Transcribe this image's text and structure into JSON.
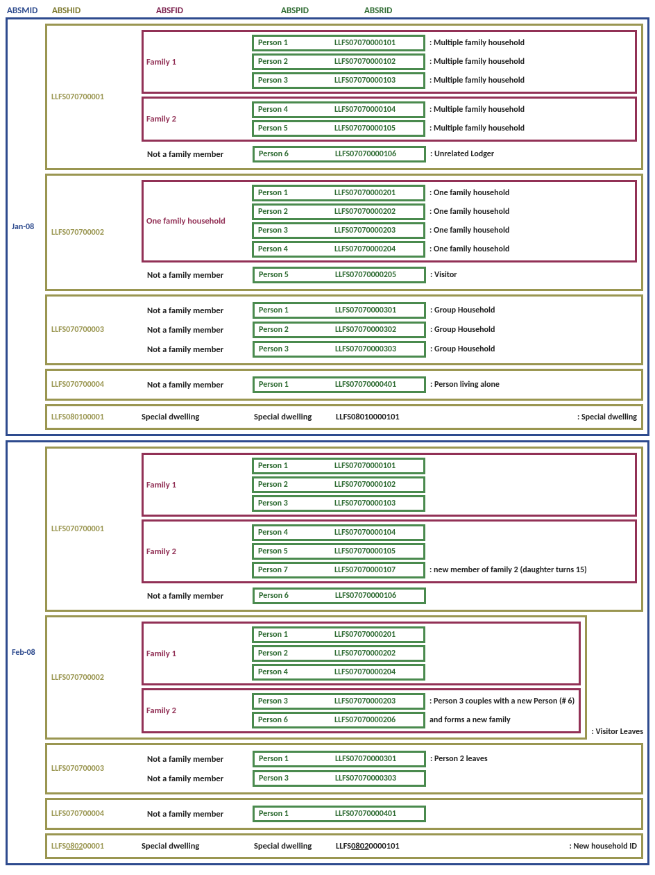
{
  "headers": {
    "absmid": "ABSMID",
    "abshid": "ABSHID",
    "absfid": "ABSFID",
    "abspid": "ABSPID",
    "absrid": "ABSRID"
  },
  "labels": {
    "not_family": "Not a family member",
    "special": "Special dwelling"
  },
  "months": [
    {
      "label": "Jan-08",
      "households": [
        {
          "id": "LLFS070700001",
          "families": [
            {
              "label": "Family 1",
              "persons": [
                {
                  "name": "Person 1",
                  "id": "LLFS07070000101",
                  "annot": ": Multiple family household"
                },
                {
                  "name": "Person 2",
                  "id": "LLFS07070000102",
                  "annot": ": Multiple family household"
                },
                {
                  "name": "Person 3",
                  "id": "LLFS07070000103",
                  "annot": ": Multiple family household"
                }
              ]
            },
            {
              "label": "Family 2",
              "persons": [
                {
                  "name": "Person 4",
                  "id": "LLFS07070000104",
                  "annot": ": Multiple family household"
                },
                {
                  "name": "Person 5",
                  "id": "LLFS07070000105",
                  "annot": ": Multiple family household"
                }
              ]
            }
          ],
          "nonfamily": [
            {
              "name": "Person 6",
              "id": "LLFS07070000106",
              "annot": ": Unrelated Lodger"
            }
          ]
        },
        {
          "id": "LLFS070700002",
          "families": [
            {
              "label": "One family household",
              "persons": [
                {
                  "name": "Person 1",
                  "id": "LLFS07070000201",
                  "annot": ": One family household"
                },
                {
                  "name": "Person 2",
                  "id": "LLFS07070000202",
                  "annot": ": One family household"
                },
                {
                  "name": "Person 3",
                  "id": "LLFS07070000203",
                  "annot": ": One family household"
                },
                {
                  "name": "Person 4",
                  "id": "LLFS07070000204",
                  "annot": ": One family household"
                }
              ]
            }
          ],
          "nonfamily": [
            {
              "name": "Person 5",
              "id": "LLFS07070000205",
              "annot": ": Visitor"
            }
          ]
        },
        {
          "id": "LLFS070700003",
          "families": [],
          "nonfamily": [
            {
              "name": "Person 1",
              "id": "LLFS07070000301",
              "annot": ": Group Household"
            },
            {
              "name": "Person 2",
              "id": "LLFS07070000302",
              "annot": ": Group Household"
            },
            {
              "name": "Person 3",
              "id": "LLFS07070000303",
              "annot": ": Group Household"
            }
          ]
        },
        {
          "id": "LLFS070700004",
          "families": [],
          "nonfamily": [
            {
              "name": "Person 1",
              "id": "LLFS07070000401",
              "annot": ": Person living alone"
            }
          ]
        },
        {
          "id": "LLFS080100001",
          "special": true,
          "special_person": "Special dwelling",
          "special_id": "LLFS08010000101",
          "annot": ": Special dwelling"
        }
      ]
    },
    {
      "label": "Feb-08",
      "households": [
        {
          "id": "LLFS070700001",
          "families": [
            {
              "label": "Family 1",
              "persons": [
                {
                  "name": "Person 1",
                  "id": "LLFS07070000101"
                },
                {
                  "name": "Person 2",
                  "id": "LLFS07070000102"
                },
                {
                  "name": "Person 3",
                  "id": "LLFS07070000103"
                }
              ]
            },
            {
              "label": "Family 2",
              "persons": [
                {
                  "name": "Person 4",
                  "id": "LLFS07070000104"
                },
                {
                  "name": "Person 5",
                  "id": "LLFS07070000105"
                },
                {
                  "name": "Person 7",
                  "id": "LLFS07070000107",
                  "annot": ": new member of family 2 (daughter turns 15)"
                }
              ]
            }
          ],
          "nonfamily": [
            {
              "name": "Person 6",
              "id": "LLFS07070000106"
            }
          ]
        },
        {
          "id": "LLFS070700002",
          "families": [
            {
              "label": "Family 1",
              "persons": [
                {
                  "name": "Person 1",
                  "id": "LLFS07070000201"
                },
                {
                  "name": "Person 2",
                  "id": "LLFS07070000202"
                },
                {
                  "name": "Person 4",
                  "id": "LLFS07070000204"
                }
              ]
            },
            {
              "label": "Family 2",
              "persons": [
                {
                  "name": "Person 3",
                  "id": "LLFS07070000203",
                  "annot": ": Person 3 couples with a new Person (# 6)"
                },
                {
                  "name": "Person 6",
                  "id": "LLFS07070000206",
                  "annot": "and forms a new family"
                }
              ]
            }
          ],
          "trailing_annot": ": Visitor Leaves"
        },
        {
          "id": "LLFS070700003",
          "families": [],
          "nonfamily": [
            {
              "name": "Person 1",
              "id": "LLFS07070000301",
              "annot": ": Person 2 leaves"
            },
            {
              "name": "Person 3",
              "id": "LLFS07070000303"
            }
          ]
        },
        {
          "id": "LLFS070700004",
          "families": [],
          "nonfamily": [
            {
              "name": "Person 1",
              "id": "LLFS07070000401"
            }
          ]
        },
        {
          "id_pre": "LLFS",
          "id_und": "0802",
          "id_post": "00001",
          "special": true,
          "underline": true,
          "special_person": "Special dwelling",
          "special_id_pre": "LLFS",
          "special_id_und": "0802",
          "special_id_post": "0000101",
          "annot": ": New household ID"
        }
      ]
    }
  ]
}
